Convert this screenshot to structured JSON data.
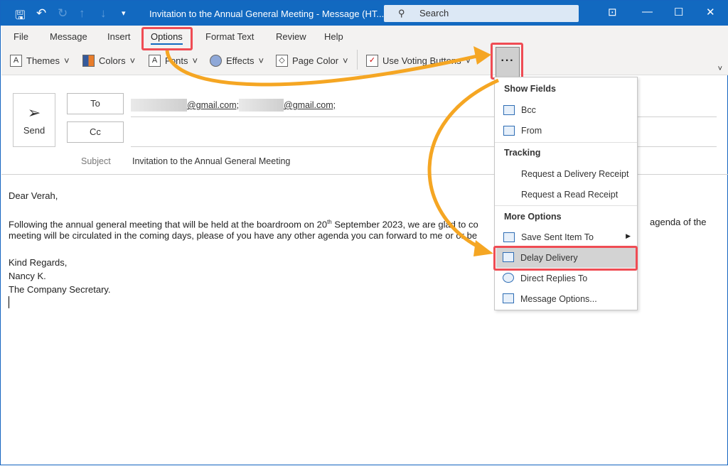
{
  "window": {
    "title": "Invitation to the Annual General Meeting  -  Message (HT...",
    "search_placeholder": "Search"
  },
  "tabs": [
    "File",
    "Message",
    "Insert",
    "Options",
    "Format Text",
    "Review",
    "Help"
  ],
  "active_tab": "Options",
  "ribbon": {
    "themes": "Themes",
    "colors": "Colors",
    "fonts": "Fonts",
    "effects": "Effects",
    "page_color": "Page Color",
    "voting": "Use Voting Buttons",
    "more": "···"
  },
  "compose": {
    "send": "Send",
    "to": "To",
    "cc": "Cc",
    "addr1": "@gmail.com;",
    "addr2": "@gmail.com;",
    "subject_label": "Subject",
    "subject": "Invitation to the Annual General Meeting"
  },
  "body": {
    "greeting": "Dear Verah,",
    "p1a": "Following the annual general meeting that will be held at the boardroom on 20",
    "p1sup": "th",
    "p1b": " September 2023, we are glad to co",
    "p1c": "agenda of the",
    "p2a": "meeting will be circulated in the coming days, please of you have any other agenda you can forward to me or or be",
    "closing": "Kind Regards,",
    "name": "Nancy K.",
    "role": "The Company Secretary."
  },
  "menu": {
    "show_fields": "Show Fields",
    "bcc": "Bcc",
    "from": "From",
    "tracking": "Tracking",
    "delivery_receipt": "Request a Delivery Receipt",
    "read_receipt": "Request a Read Receipt",
    "more_options": "More Options",
    "save_sent": "Save Sent Item To",
    "delay": "Delay Delivery",
    "direct_replies": "Direct Replies To",
    "message_options": "Message Options..."
  },
  "colors": {
    "title_bar": "#1269c0",
    "highlight": "#ef4c54",
    "arrow": "#f5a623"
  }
}
